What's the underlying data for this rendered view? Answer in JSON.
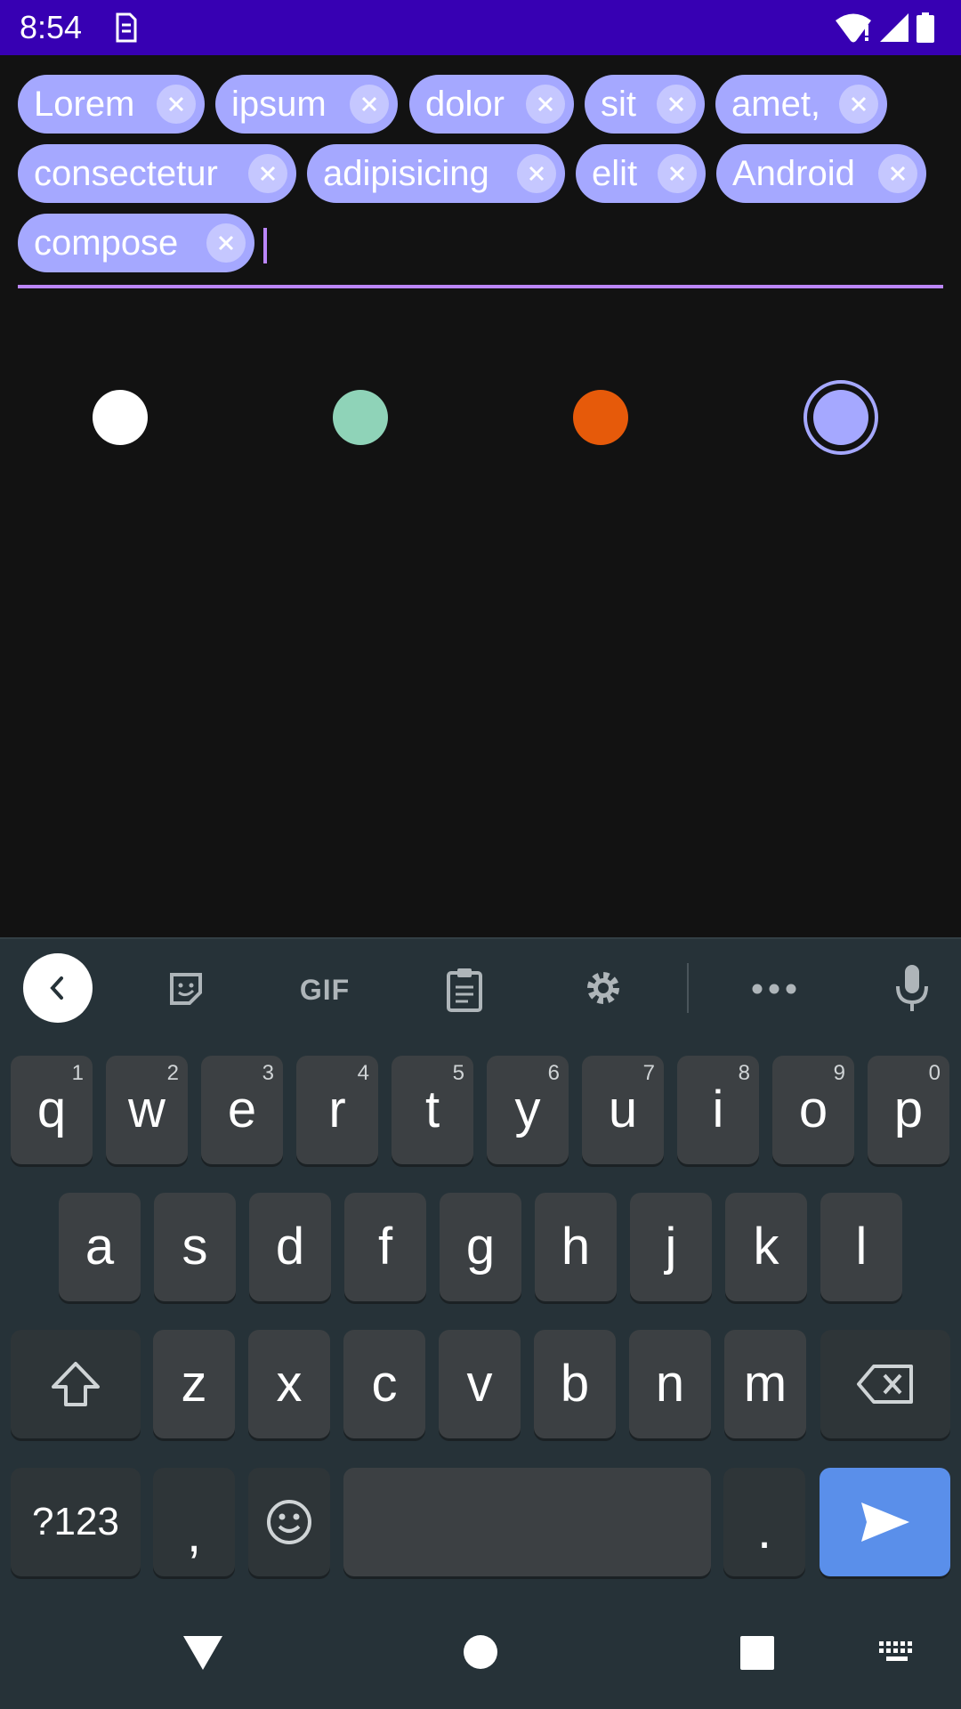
{
  "status_bar": {
    "time": "8:54"
  },
  "chips": [
    {
      "label": "Lorem"
    },
    {
      "label": "ipsum"
    },
    {
      "label": "dolor"
    },
    {
      "label": "sit"
    },
    {
      "label": "amet,"
    },
    {
      "label": "consectetur"
    },
    {
      "label": "adipisicing"
    },
    {
      "label": "elit"
    },
    {
      "label": "Android"
    },
    {
      "label": "compose"
    }
  ],
  "colors": {
    "chip_bg": "#a5a8ff",
    "underline": "#bb86fc",
    "picker": [
      "#ffffff",
      "#8fd3b8",
      "#e65a0a",
      "#a5a8ff"
    ],
    "selected_index": 3
  },
  "keyboard": {
    "row1": [
      {
        "k": "q",
        "h": "1"
      },
      {
        "k": "w",
        "h": "2"
      },
      {
        "k": "e",
        "h": "3"
      },
      {
        "k": "r",
        "h": "4"
      },
      {
        "k": "t",
        "h": "5"
      },
      {
        "k": "y",
        "h": "6"
      },
      {
        "k": "u",
        "h": "7"
      },
      {
        "k": "i",
        "h": "8"
      },
      {
        "k": "o",
        "h": "9"
      },
      {
        "k": "p",
        "h": "0"
      }
    ],
    "row2": [
      "a",
      "s",
      "d",
      "f",
      "g",
      "h",
      "j",
      "k",
      "l"
    ],
    "row3": [
      "z",
      "x",
      "c",
      "v",
      "b",
      "n",
      "m"
    ],
    "symbols_label": "?123",
    "comma_label": ",",
    "period_label": ".",
    "gif_label": "GIF"
  }
}
